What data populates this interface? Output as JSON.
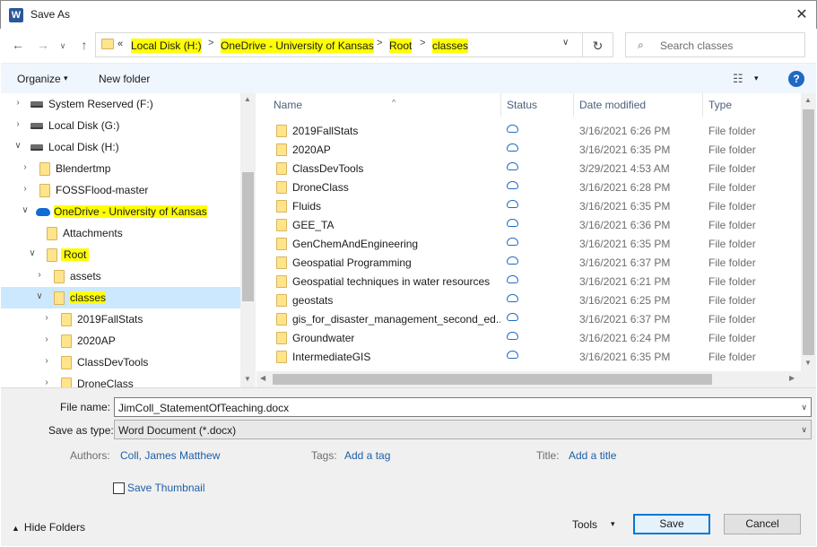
{
  "window": {
    "title": "Save As",
    "app_icon": "W",
    "close": "✕"
  },
  "nav": {
    "back": "←",
    "forward": "→",
    "recent": "∨",
    "up": "↑",
    "refresh": "↻"
  },
  "address": {
    "overflow": "«",
    "crumbs": [
      "Local Disk (H:)",
      "OneDrive - University of Kansas",
      "Root",
      "classes"
    ],
    "separator": ">",
    "dropdown": "∨"
  },
  "search": {
    "placeholder": "Search classes",
    "icon": "⌕"
  },
  "toolbar": {
    "organize": "Organize",
    "new_folder": "New folder",
    "view": "☷",
    "help": "?",
    "caret": "▾"
  },
  "tree": [
    {
      "label": "System Reserved (F:)",
      "kind": "drive",
      "chevron": "›"
    },
    {
      "label": "Local Disk (G:)",
      "kind": "drive",
      "chevron": "›"
    },
    {
      "label": "Local Disk (H:)",
      "kind": "drive",
      "chevron": "∨"
    },
    {
      "label": "Blendertmp",
      "kind": "folder",
      "chevron": "›"
    },
    {
      "label": "FOSSFlood-master",
      "kind": "folder",
      "chevron": "›"
    },
    {
      "label": "OneDrive - University of Kansas",
      "kind": "cloud",
      "chevron": "∨"
    },
    {
      "label": "Attachments",
      "kind": "folder",
      "chevron": ""
    },
    {
      "label": "Root",
      "kind": "folder",
      "chevron": "∨"
    },
    {
      "label": "assets",
      "kind": "folder",
      "chevron": "›"
    },
    {
      "label": "classes",
      "kind": "folder",
      "chevron": "∨"
    },
    {
      "label": "2019FallStats",
      "kind": "folder",
      "chevron": "›"
    },
    {
      "label": "2020AP",
      "kind": "folder",
      "chevron": "›"
    },
    {
      "label": "ClassDevTools",
      "kind": "folder",
      "chevron": "›"
    },
    {
      "label": "DroneClass",
      "kind": "folder",
      "chevron": "›"
    }
  ],
  "columns": {
    "name": "Name",
    "status": "Status",
    "date": "Date modified",
    "type": "Type",
    "sort_arrow": "^"
  },
  "files": [
    {
      "name": "2019FallStats",
      "date": "3/16/2021 6:26 PM",
      "type": "File folder"
    },
    {
      "name": "2020AP",
      "date": "3/16/2021 6:35 PM",
      "type": "File folder"
    },
    {
      "name": "ClassDevTools",
      "date": "3/29/2021 4:53 AM",
      "type": "File folder"
    },
    {
      "name": "DroneClass",
      "date": "3/16/2021 6:28 PM",
      "type": "File folder"
    },
    {
      "name": "Fluids",
      "date": "3/16/2021 6:35 PM",
      "type": "File folder"
    },
    {
      "name": "GEE_TA",
      "date": "3/16/2021 6:36 PM",
      "type": "File folder"
    },
    {
      "name": "GenChemAndEngineering",
      "date": "3/16/2021 6:35 PM",
      "type": "File folder"
    },
    {
      "name": "Geospatial Programming",
      "date": "3/16/2021 6:37 PM",
      "type": "File folder"
    },
    {
      "name": "Geospatial techniques in water resources",
      "date": "3/16/2021 6:21 PM",
      "type": "File folder"
    },
    {
      "name": "geostats",
      "date": "3/16/2021 6:25 PM",
      "type": "File folder"
    },
    {
      "name": "gis_for_disaster_management_second_ed...",
      "date": "3/16/2021 6:37 PM",
      "type": "File folder"
    },
    {
      "name": "Groundwater",
      "date": "3/16/2021 6:24 PM",
      "type": "File folder"
    },
    {
      "name": "IntermediateGIS",
      "date": "3/16/2021 6:35 PM",
      "type": "File folder"
    }
  ],
  "form": {
    "filename_label": "File name:",
    "filename_value": "JimColl_StatementOfTeaching.docx",
    "savetype_label": "Save as type:",
    "savetype_value": "Word Document (*.docx)",
    "authors_label": "Authors:",
    "authors_value": "Coll, James Matthew",
    "tags_label": "Tags:",
    "tags_value": "Add a tag",
    "title_label": "Title:",
    "title_value": "Add a title",
    "thumbnail_label": "Save Thumbnail"
  },
  "footer": {
    "hide_folders": "Hide Folders",
    "hide_icon": "▲",
    "tools": "Tools",
    "save": "Save",
    "cancel": "Cancel"
  },
  "scroll": {
    "up": "▲",
    "down": "▼",
    "left": "◀",
    "right": "▶"
  },
  "colors": {
    "highlight": "#ffff00",
    "selection": "#cce8ff",
    "accent": "#0078d7",
    "link": "#1f5fa8"
  }
}
